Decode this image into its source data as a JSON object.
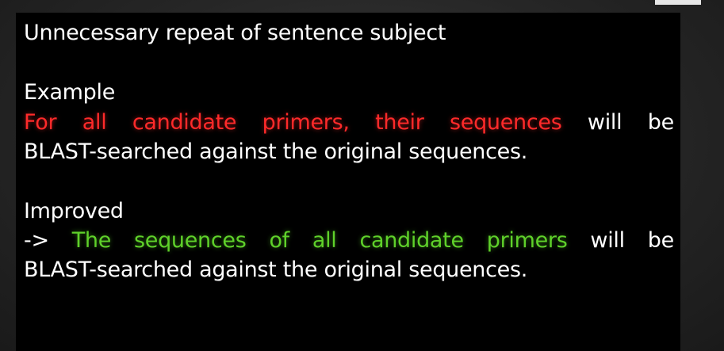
{
  "slide": {
    "heading": "Unnecessary repeat of sentence subject",
    "example": {
      "label": "Example",
      "line1_words": [
        "For",
        "all",
        "candidate",
        "primers,",
        "their",
        "sequences"
      ],
      "line1_rest": [
        "will",
        "be"
      ],
      "line2": "BLAST-searched against the original sequences."
    },
    "improved": {
      "label": "Improved",
      "arrow": "->",
      "line1_words": [
        "The",
        "sequences",
        "of",
        "all",
        "candidate",
        "primers"
      ],
      "line1_rest": [
        "will",
        "be"
      ],
      "line2": "BLAST-searched against the original sequences."
    }
  },
  "colors": {
    "background": "#000000",
    "text": "#ffffff",
    "highlight_bad": "#ff2a2a",
    "highlight_good": "#5fd12a"
  }
}
